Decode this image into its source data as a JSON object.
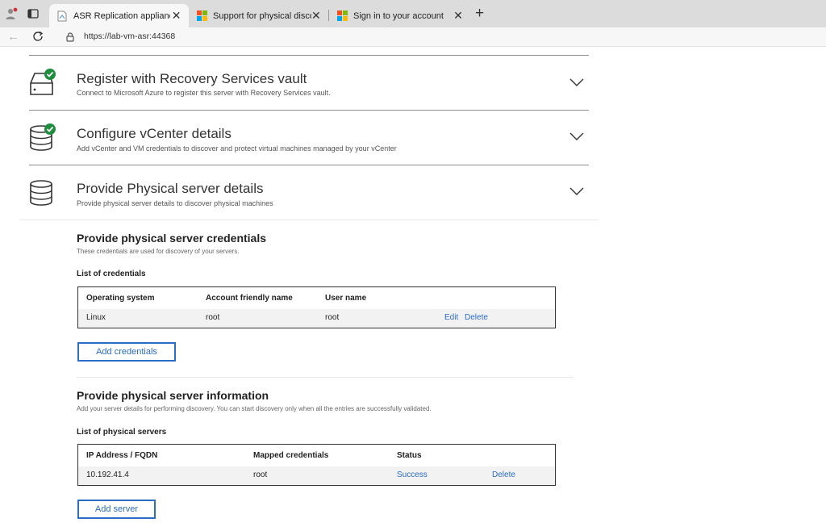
{
  "browser": {
    "tabs": [
      {
        "title": "ASR Replication appliance"
      },
      {
        "title": "Support for physical discovery ar"
      },
      {
        "title": "Sign in to your account"
      }
    ],
    "url": "https://lab-vm-asr:44368"
  },
  "sections": [
    {
      "title": "Register with Recovery Services vault",
      "desc": "Connect to Microsoft Azure to register this server with Recovery Services vault.",
      "icon": "vault-check-icon",
      "completed": true
    },
    {
      "title": "Configure vCenter details",
      "desc": "Add vCenter and VM credentials to discover and protect virtual machines managed by your vCenter",
      "icon": "database-check-icon",
      "completed": true
    },
    {
      "title": "Provide Physical server details",
      "desc": "Provide physical server details to discover physical machines",
      "icon": "database-icon",
      "completed": false
    }
  ],
  "credentials": {
    "heading": "Provide physical server credentials",
    "subtitle": "These credentials are used for discovery of your servers.",
    "list_label": "List of credentials",
    "columns": [
      "Operating system",
      "Account friendly name",
      "User name"
    ],
    "rows": [
      {
        "os": "Linux",
        "friendly_name": "root",
        "user_name": "root",
        "edit": "Edit",
        "delete": "Delete"
      }
    ],
    "add_button": "Add credentials"
  },
  "servers": {
    "heading": "Provide physical server information",
    "subtitle": "Add your server details for performing discovery. You can start discovery only when all the entries are successfully validated.",
    "list_label": "List of physical servers",
    "columns": [
      "IP Address / FQDN",
      "Mapped credentials",
      "Status"
    ],
    "rows": [
      {
        "ip": "10.192.41.4",
        "mapped": "root",
        "status": "Success",
        "delete": "Delete"
      }
    ],
    "add_button": "Add server"
  },
  "colors": {
    "accent": "#2b6cc4",
    "success_check": "#1e8e3e"
  }
}
